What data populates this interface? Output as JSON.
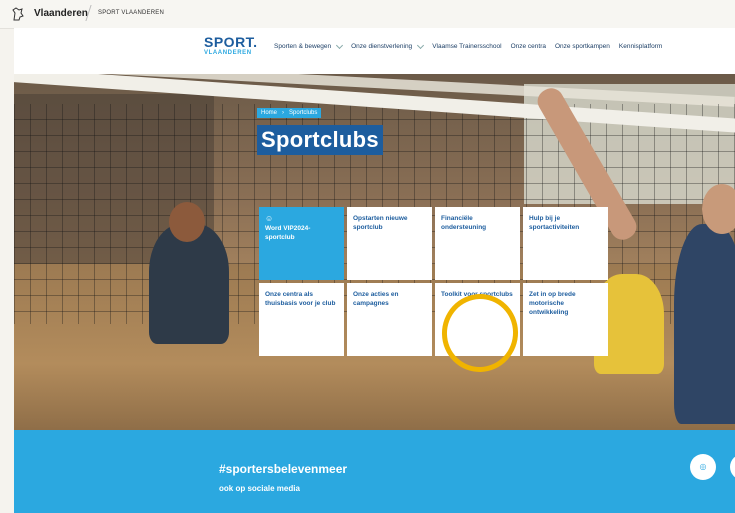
{
  "topbar": {
    "brand": "Vlaanderen",
    "org": "SPORT VLAANDEREN"
  },
  "header": {
    "logo_line1": "SPORT.",
    "logo_line2": "VLAANDEREN",
    "menu": [
      {
        "label": "Sporten & bewegen",
        "has_dropdown": true
      },
      {
        "label": "Onze dienstverlening",
        "has_dropdown": true
      },
      {
        "label": "Vlaamse Trainersschool",
        "has_dropdown": false
      },
      {
        "label": "Onze centra",
        "has_dropdown": false
      },
      {
        "label": "Onze sportkampen",
        "has_dropdown": false
      },
      {
        "label": "Kennisplatform",
        "has_dropdown": false
      }
    ]
  },
  "hero": {
    "breadcrumb": [
      "Home",
      "Sportclubs"
    ],
    "title": "Sportclubs"
  },
  "tiles": [
    {
      "star": "☺",
      "label": "Word VIP2024-sportclub",
      "highlight": true
    },
    {
      "label": "Opstarten nieuwe sportclub"
    },
    {
      "label": "Financiële ondersteuning"
    },
    {
      "label": "Hulp bij je sportactiviteiten"
    },
    {
      "label": "Onze centra als thuisbasis voor je club"
    },
    {
      "label": "Onze acties en campagnes"
    },
    {
      "label": "Toolkit voor sportclubs"
    },
    {
      "label": "Zet in op brede motorische ontwikkeling"
    }
  ],
  "social": {
    "hashtag": "#sportersbelevenmeer",
    "subtitle": "ook op sociale media",
    "icons": [
      "instagram-icon"
    ]
  },
  "colors": {
    "brand_dark": "#1d5d9e",
    "brand_light": "#2ba8e0",
    "annotation": "#f0b400"
  }
}
